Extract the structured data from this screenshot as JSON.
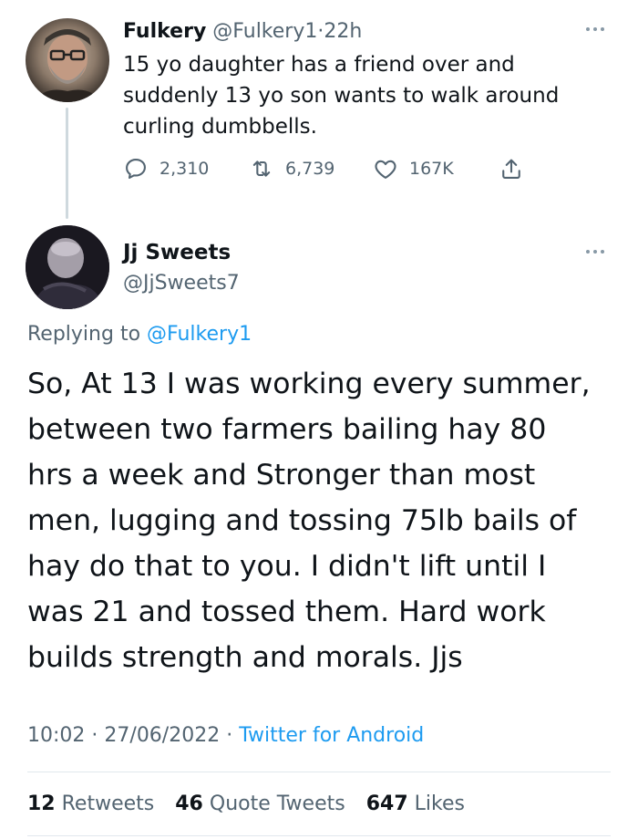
{
  "tweet1": {
    "name": "Fulkery",
    "handle": "@Fulkery1",
    "separator": "·",
    "time": "22h",
    "text_lines": [
      "15 yo daughter has a friend over and",
      "suddenly 13 yo son wants to walk around",
      "curling dumbbells."
    ],
    "actions": {
      "replies": "2,310",
      "retweets": "6,739",
      "likes": "167K"
    }
  },
  "tweet2": {
    "name": "Jj Sweets",
    "handle": "@JjSweets7",
    "replying_prefix": "Replying to",
    "replying_to": "@Fulkery1",
    "text_lines": [
      "So, At 13 I was working every summer,",
      "between two farmers bailing hay 80",
      "hrs a week and Stronger than most",
      "men, lugging and tossing 75lb bails of",
      "hay do that to you. I didn't lift until I",
      "was 21 and tossed them. Hard work",
      "builds strength and morals. Jjs"
    ],
    "time": "10:02",
    "date": "27/06/2022",
    "meta_separator": "·",
    "source": "Twitter for Android",
    "stats": {
      "retweets_count": "12",
      "retweets_label": "Retweets",
      "quote_count": "46",
      "quote_label": "Quote Tweets",
      "likes_count": "647",
      "likes_label": "Likes"
    }
  },
  "icons": {
    "reply": "reply-icon",
    "retweet": "retweet-icon",
    "like": "heart-icon",
    "share": "share-icon",
    "more": "more-icon"
  },
  "colors": {
    "text": "#0f1419",
    "secondary": "#536471",
    "link": "#1d9bf0",
    "divider": "#e1e8ed"
  }
}
